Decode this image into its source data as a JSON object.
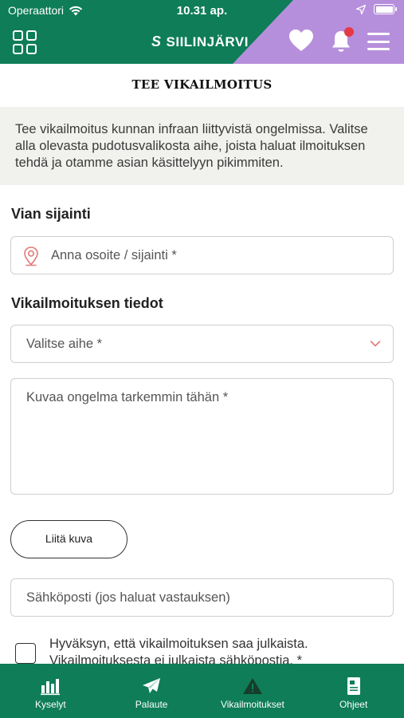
{
  "status_bar": {
    "carrier": "Operaattori",
    "time": "10.31 ap."
  },
  "header": {
    "brand": "SIILINJÄRVI",
    "brand_logo": "S",
    "colors": {
      "green": "#0e7d58",
      "purple": "#b68fdc",
      "notification_dot": "#e53945"
    },
    "icons": [
      "menu-grid-icon",
      "heart-icon",
      "bell-icon",
      "hamburger-menu-icon"
    ]
  },
  "page": {
    "title": "TEE VIKAILMOITUS",
    "intro": "Tee vikailmoitus kunnan infraan liittyvistä ongelmissa. Valitse alla olevasta pudotusvalikosta aihe, joista haluat ilmoituksen tehdä ja otamme asian käsittelyyn pikimmiten."
  },
  "form": {
    "location_label": "Vian sijainti",
    "location_placeholder": "Anna osoite / sijainti *",
    "details_label": "Vikailmoituksen tiedot",
    "topic_placeholder": "Valitse aihe *",
    "description_placeholder": "Kuvaa ongelma tarkemmin tähän *",
    "attach_label": "Liitä kuva",
    "email_placeholder": "Sähköposti (jos haluat vastauksen)",
    "consent_text": "Hyväksyn, että vikailmoituksen saa julkaista. Vikailmoituksesta ei julkaista sähköpostia. *",
    "consent_checked": false
  },
  "tabs": [
    {
      "label": "Kyselyt",
      "icon": "bar-chart-icon"
    },
    {
      "label": "Palaute",
      "icon": "paper-plane-icon"
    },
    {
      "label": "Vikailmoitukset",
      "icon": "warning-icon"
    },
    {
      "label": "Ohjeet",
      "icon": "document-icon"
    }
  ]
}
